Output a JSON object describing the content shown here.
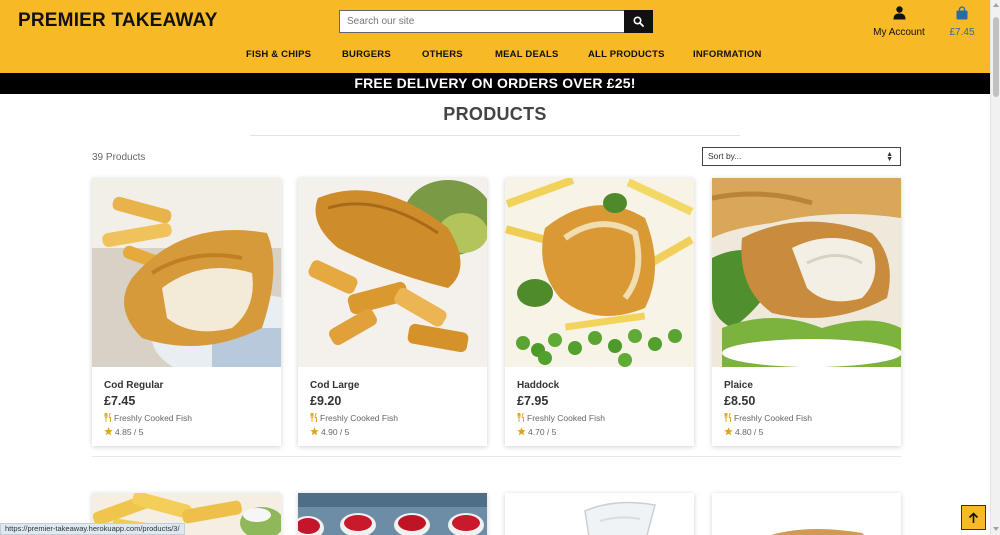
{
  "header": {
    "logo": "PREMIER TAKEAWAY",
    "search_placeholder": "Search our site",
    "account_label": "My Account",
    "cart_total": "£7.45",
    "colors": {
      "brand_yellow": "#f7b925",
      "cart_blue": "#2a6aa8",
      "black": "#000000"
    }
  },
  "nav": {
    "items": [
      {
        "label": "FISH & CHIPS"
      },
      {
        "label": "BURGERS"
      },
      {
        "label": "OTHERS"
      },
      {
        "label": "MEAL DEALS"
      },
      {
        "label": "ALL PRODUCTS"
      },
      {
        "label": "INFORMATION"
      }
    ]
  },
  "banner": {
    "text": "FREE DELIVERY ON ORDERS OVER £25!"
  },
  "main": {
    "title": "PRODUCTS",
    "count": "39 Products",
    "sort_label": "Sort by..."
  },
  "products": [
    {
      "name": "Cod Regular",
      "price": "£7.45",
      "category": "Freshly Cooked Fish",
      "rating": "4.85 / 5",
      "icon": "fish-chips-photo"
    },
    {
      "name": "Cod Large",
      "price": "£9.20",
      "category": "Freshly Cooked Fish",
      "rating": "4.90 / 5",
      "icon": "fish-chips-photo"
    },
    {
      "name": "Haddock",
      "price": "£7.95",
      "category": "Freshly Cooked Fish",
      "rating": "4.70 / 5",
      "icon": "fish-peas-photo"
    },
    {
      "name": "Plaice",
      "price": "£8.50",
      "category": "Freshly Cooked Fish",
      "rating": "4.80 / 5",
      "icon": "fish-salad-photo"
    }
  ],
  "status": {
    "url": "https://premier-takeaway.herokuapp.com/products/3/"
  }
}
